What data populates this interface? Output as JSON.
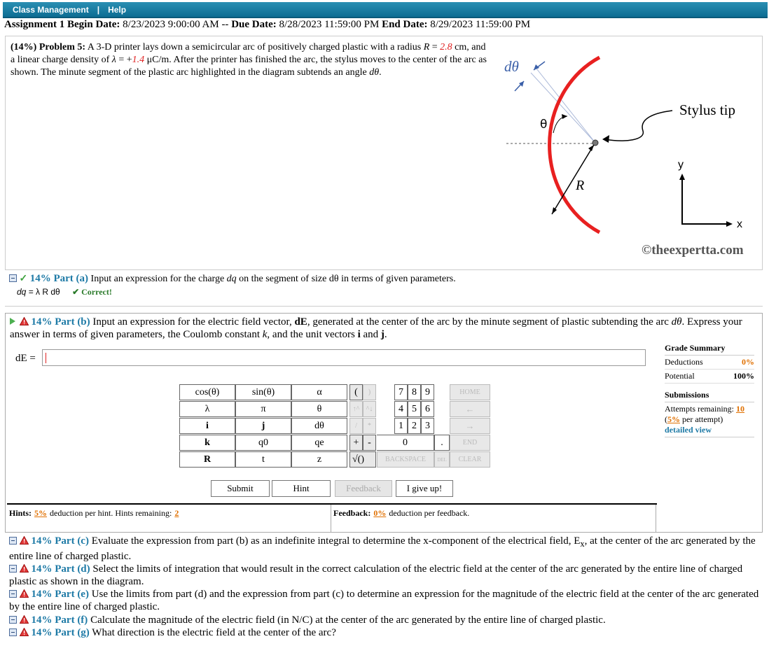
{
  "topbar": {
    "class_management": "Class Management",
    "separator": "|",
    "help": "Help"
  },
  "assignment": {
    "title": "Assignment 1",
    "begin_label": "Begin Date:",
    "begin": "8/23/2023 9:00:00 AM",
    "dash": "--",
    "due_label": "Due Date:",
    "due": "8/28/2023 11:59:00 PM",
    "end_label": "End Date:",
    "end": "8/29/2023 11:59:00 PM"
  },
  "problem": {
    "weight": "(14%)",
    "number": "Problem 5:",
    "text_1": "A 3-D printer lays down a semicircular arc of positively charged plastic with a radius",
    "R_sym": "R",
    "eq": " = ",
    "R_value": "2.8",
    "R_unit": " cm, and a linear charge density of",
    "lambda_sym": "λ",
    "eq2": " = +",
    "lambda_value": "1.4",
    "lambda_unit": " μC/m. After the printer has finished the arc, the stylus moves to the center of the arc as shown. The minute segment of the plastic arc highlighted in the diagram subtends an angle",
    "dtheta": "dθ",
    "end": "."
  },
  "diagram": {
    "dtheta_label": "dθ",
    "theta_label": "θ",
    "R_label": "R",
    "stylus_label": "Stylus tip",
    "y_label": "y",
    "x_label": "x",
    "watermark": "©theexpertta.com",
    "arc_color": "#e82020",
    "arrow_color": "#3a5fa8"
  },
  "part_a": {
    "label": "14% Part (a)",
    "prompt_1": "Input an expression for the charge",
    "dq": "dq",
    "prompt_2": "on the segment of size dθ in terms of given parameters.",
    "answer_sym": "dq",
    "answer": " = λ R dθ",
    "status": "✔ Correct!"
  },
  "part_b": {
    "label": "14% Part (b)",
    "prompt_1": "Input an expression for the electric field vector,",
    "dE": "dE",
    "prompt_2": ", generated at the center of the arc by the minute segment of plastic subtending the arc",
    "dtheta": "dθ",
    "prompt_3": ". Express your answer in terms of given parameters, the Coulomb constant",
    "k": "k",
    "prompt_4": ", and the unit vectors",
    "i": "i",
    "and": "and",
    "j": "j",
    "end": ".",
    "input_label": "dE =",
    "input_value": ""
  },
  "grade_summary": {
    "title": "Grade Summary",
    "deductions_label": "Deductions",
    "deductions": "0%",
    "potential_label": "Potential",
    "potential": "100%"
  },
  "submissions": {
    "title": "Submissions",
    "attempts_label": "Attempts remaining:",
    "attempts": "10",
    "per_attempt": "5%",
    "per_attempt_label": "per attempt)",
    "open_paren": "(",
    "detailed": "detailed view"
  },
  "keypad": {
    "fn_keys": [
      "cos(θ)",
      "sin(θ)",
      "α",
      "λ",
      "π",
      "θ",
      "i",
      "j",
      "dθ",
      "k",
      "q0",
      "qe",
      "R",
      "t",
      "z"
    ],
    "paren": [
      "(",
      ")"
    ],
    "digits": [
      "7",
      "8",
      "9",
      "4",
      "5",
      "6",
      "1",
      "2",
      "3",
      "0"
    ],
    "ops": [
      "↑^",
      "^↓",
      "/",
      "*",
      "+",
      "-",
      "√()"
    ],
    "dot": ".",
    "home": "HOME",
    "left": "←",
    "right": "→",
    "end": "END",
    "backspace": "BACKSPACE",
    "del": "DEL",
    "clear": "CLEAR"
  },
  "actions": {
    "submit": "Submit",
    "hint": "Hint",
    "feedback": "Feedback",
    "give_up": "I give up!"
  },
  "hints": {
    "hints_label": "Hints:",
    "hints_pct": "5%",
    "hints_text": "deduction per hint. Hints remaining:",
    "hints_remaining": "2",
    "feedback_label": "Feedback:",
    "feedback_pct": "0%",
    "feedback_text": "deduction per feedback."
  },
  "later_parts": [
    {
      "label": "14% Part (c)",
      "text": "Evaluate the expression from part (b) as an indefinite integral to determine the x-component of the electrical field, E",
      "sub": "x",
      "text2": ", at the center of the arc generated by the entire line of charged plastic."
    },
    {
      "label": "14% Part (d)",
      "text": "Select the limits of integration that would result in the correct calculation of the electric field at the center of the arc generated by the entire line of charged plastic as shown in the diagram."
    },
    {
      "label": "14% Part (e)",
      "text": "Use the limits from part (d) and the expression from part (c) to determine an expression for the magnitude of the electric field at the center of the arc generated by the entire line of charged plastic."
    },
    {
      "label": "14% Part (f)",
      "text": "Calculate the magnitude of the electric field (in N/C) at the center of the arc generated by the entire line of charged plastic."
    },
    {
      "label": "14% Part (g)",
      "text": "What direction is the electric field at the center of the arc?"
    }
  ]
}
